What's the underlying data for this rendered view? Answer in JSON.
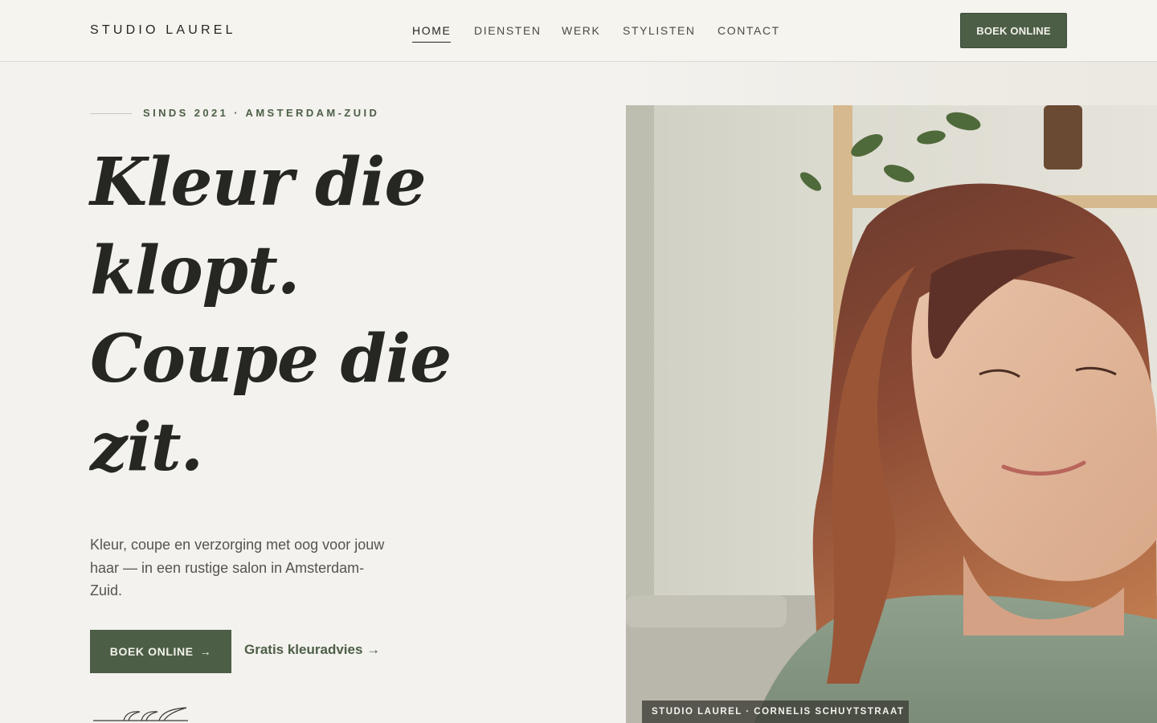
{
  "brand": {
    "name": "STUDIO LAUREL"
  },
  "nav": {
    "items": [
      {
        "label": "HOME",
        "active": true
      },
      {
        "label": "DIENSTEN",
        "active": false
      },
      {
        "label": "WERK",
        "active": false
      },
      {
        "label": "STYLISTEN",
        "active": false
      },
      {
        "label": "CONTACT",
        "active": false
      }
    ],
    "cta_label": "BOEK ONLINE"
  },
  "hero": {
    "kicker": "SINDS 2021 · AMSTERDAM-ZUID",
    "headline_lines": [
      "Kleur die",
      "klopt.",
      "Coupe die",
      "zit."
    ],
    "lead": "Kleur, coupe en verzorging met oog voor jouw haar — in een rustige salon in Amsterdam-Zuid.",
    "primary_cta": "BOEK ONLINE",
    "primary_cta_arrow": "→",
    "secondary_cta": "Gratis kleuradvies →",
    "image_caption": "STUDIO LAUREL · CORNELIS SCHUYTSTRAAT"
  },
  "colors": {
    "background": "#f3f2ee",
    "accent_green": "#4d5e47",
    "text_dark": "#262622",
    "text_muted": "#55554f"
  },
  "icons": {
    "decoration": "leaf-sprig-icon",
    "arrow": "arrow-right-icon"
  }
}
